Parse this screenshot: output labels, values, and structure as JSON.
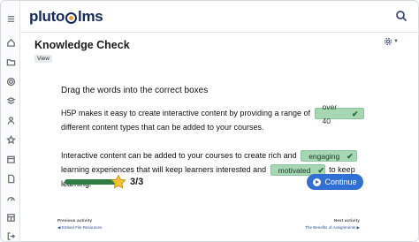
{
  "app": {
    "logo_left": "pluto",
    "logo_right": "lms"
  },
  "rail": {
    "icons": [
      "menu-icon",
      "home-icon",
      "folder-icon",
      "settings-icon",
      "layers-icon",
      "user-icon",
      "star-icon",
      "calendar-icon",
      "document-icon",
      "gauge-icon",
      "table-icon",
      "logout-icon"
    ]
  },
  "page": {
    "title": "Knowledge Check",
    "badge": "View"
  },
  "activity": {
    "instruction": "Drag the words into the correct boxes",
    "p1_before": "H5P makes it easy to create interactive content by providing a range of",
    "p1_drop": "over 40",
    "p1_after": "different content types that can be added to your courses.",
    "p2_before": "Interactive content can be added to your courses to create rich and",
    "p2_drop1": "engaging",
    "p2_middle1": "learning experiences that will keep learners interested and",
    "p2_drop2": "motivated",
    "p2_after": "to keep learning.",
    "score": "3/3",
    "progress": 1.0,
    "continue_label": "Continue"
  },
  "nav": {
    "prev_caption": "Previous activity",
    "prev_link": "◀ Embed File Resources",
    "next_caption": "Next activity",
    "next_link": "The Benefits of Assignments ▶"
  },
  "colors": {
    "brand": "#152a5c",
    "correct_bg": "#a6d6b2",
    "progress": "#2f7d41",
    "button": "#2f6fd6"
  }
}
